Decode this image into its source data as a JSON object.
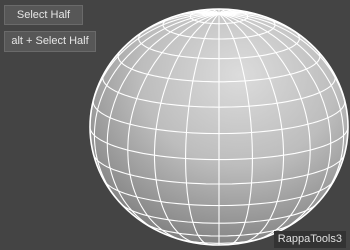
{
  "toolbar": {
    "select_half_label": "Select Half",
    "alt_select_half_label": "alt + Select Half"
  },
  "branding": {
    "label": "RappaTools3"
  },
  "colors": {
    "viewport_bg": "#444444",
    "button_bg": "#575757",
    "button_text": "#e6e6e6",
    "wireframe": "#ffffff",
    "sphere_light": "#d9d9d9",
    "sphere_dark": "#6f6f6f"
  }
}
